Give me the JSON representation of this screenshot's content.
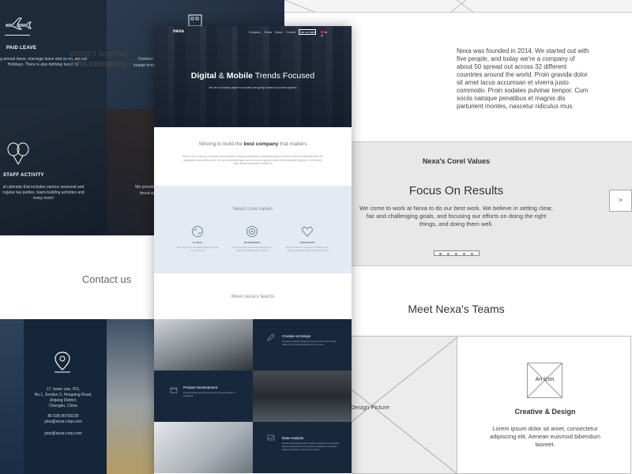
{
  "left_mockup": {
    "paid_leave_title": "PAID LEAVE",
    "paid_leave_text": "g annual leave, marriage leave and so on, are nal Holidays. There is also birthday leave for",
    "cell2_text_1": "Comerci",
    "cell2_text_2": "lounge bring",
    "staff_activity_title": "STAFF ACTIVITY",
    "staff_activity_text": "al calendar that includes various seasonal and regular tea parties, team-building activities and many more!",
    "cell4_text_1": "We provide",
    "cell4_text_2": "found ar",
    "contact_title": "Contact us",
    "address_lines": [
      "17, tower one, IFS,",
      "No.1, Section 3, Hongxing Road,",
      "Jinjiang District,",
      "Chengdu, China"
    ],
    "phone": "86 028 86706239",
    "email_1": "jobs@nexa-corp.com",
    "email_2": "jobs@nexa-corp.com"
  },
  "center_mockup": {
    "logo": "nexa",
    "nav": [
      "Company",
      "Teams",
      "Space",
      "Contact"
    ],
    "join_button": "Join our team",
    "language": "中文",
    "hero_title_1": "Digital",
    "hero_title_2": " & ",
    "hero_title_3": "Mobile",
    "hero_title_4": " Trends Focused",
    "hero_subtitle": "We are a company eager for success and going forward to success together",
    "striving_1": "Striving to build the ",
    "striving_2": "best company",
    "striving_3": " that matters",
    "striving_text": "Nexa Corp is a young, innovative and dynamic company specialized in spreading internet media content through websites and applications around the world. We are constantly eager for success and going forward with employees together. In the future, Nexa strives to become a leader in",
    "values_title": "Nexa's core values",
    "values": [
      {
        "label": "GLOBAL",
        "text": "We compete on the global stage and grow in only the best"
      },
      {
        "label": "DETERMINED",
        "text": "We work hard, act fast and efficiently to make Nexa difficult than it can be"
      },
      {
        "label": "PASSIONATE",
        "text": "We love what we do strive to challenge and produce awesome results that mean things"
      }
    ],
    "teams_title": "Meet nexa's teams",
    "teams": [
      {
        "name": "Creative & Design",
        "text": "Creative & Design brings the creative spirit and crafting ideas into visual experiences for our users"
      },
      {
        "name": "Product Development",
        "text": "Product design and development in the best ideas to marketing"
      },
      {
        "name": "Data Analysis",
        "text": "We are data analysts who employ insights and forecasting business processes for the ground operations and ideas achieving effective solutions for clients"
      }
    ]
  },
  "right_mockup": {
    "leading_1": "world's leading",
    "leading_2": "edia company.",
    "founded_text": "Nexa was founded in 2014. We started out with five people, and today we're a company of about 50 spread out across 32 different countries around the world. Proin gravida dolor sit amet lacus accumsan et viverra justo commodo. Proin sodales pulvinar tempor. Cum sociis natoque penatibus et magnis dis parturient montes, nascetur ridiculus mus.",
    "corel_title": "Nexa's Corel Values",
    "focus_title": "Focus On Results",
    "focus_text": "We come to work at Nexa to do our best work. We believe in setting clear, fair and challenging goals, and focusing our efforts on doing the right things, and doing them well.",
    "next_button": ">",
    "meet_title": "Meet Nexa's Teams",
    "design_picture": "Design Picture",
    "an_icon": "An Icon",
    "creative_title": "Creative & Design",
    "lorem": "Lorem ipsum dolor sit amet, consectetur adipiscing elit. Aenean euismod bibendum laoreet."
  }
}
